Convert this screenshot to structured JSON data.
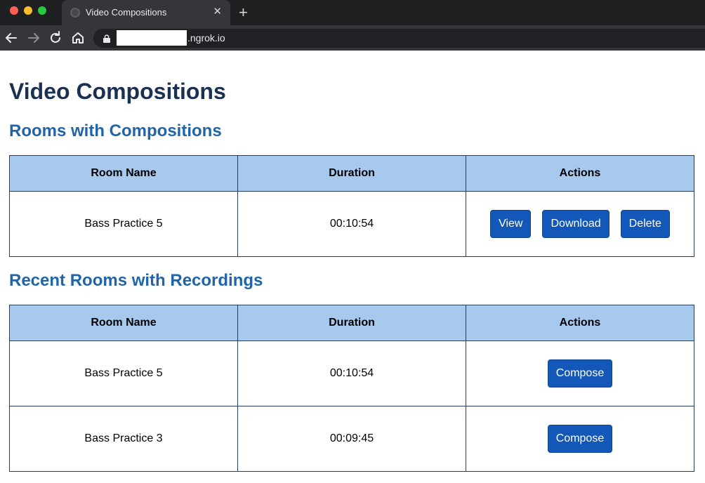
{
  "browser": {
    "tab_title": "Video Compositions",
    "tab_close": "✕",
    "new_tab": "+",
    "url_visible": ".ngrok.io"
  },
  "page": {
    "title": "Video Compositions",
    "compositions": {
      "heading": "Rooms with Compositions",
      "columns": [
        "Room Name",
        "Duration",
        "Actions"
      ],
      "rows": [
        {
          "room": "Bass Practice 5",
          "duration": "00:10:54",
          "actions": {
            "view": "View",
            "download": "Download",
            "delete": "Delete"
          }
        }
      ]
    },
    "recordings": {
      "heading": "Recent Rooms with Recordings",
      "columns": [
        "Room Name",
        "Duration",
        "Actions"
      ],
      "rows": [
        {
          "room": "Bass Practice 5",
          "duration": "00:10:54",
          "action": "Compose"
        },
        {
          "room": "Bass Practice 3",
          "duration": "00:09:45",
          "action": "Compose"
        }
      ]
    }
  },
  "colors": {
    "title": "#1a3151",
    "heading": "#2164a8",
    "header_bg": "#a7c9ee",
    "button": "#1358b8"
  },
  "icons": [
    "globe-icon",
    "close-icon",
    "plus-icon",
    "back-arrow-icon",
    "forward-arrow-icon",
    "reload-icon",
    "home-icon",
    "lock-icon"
  ]
}
